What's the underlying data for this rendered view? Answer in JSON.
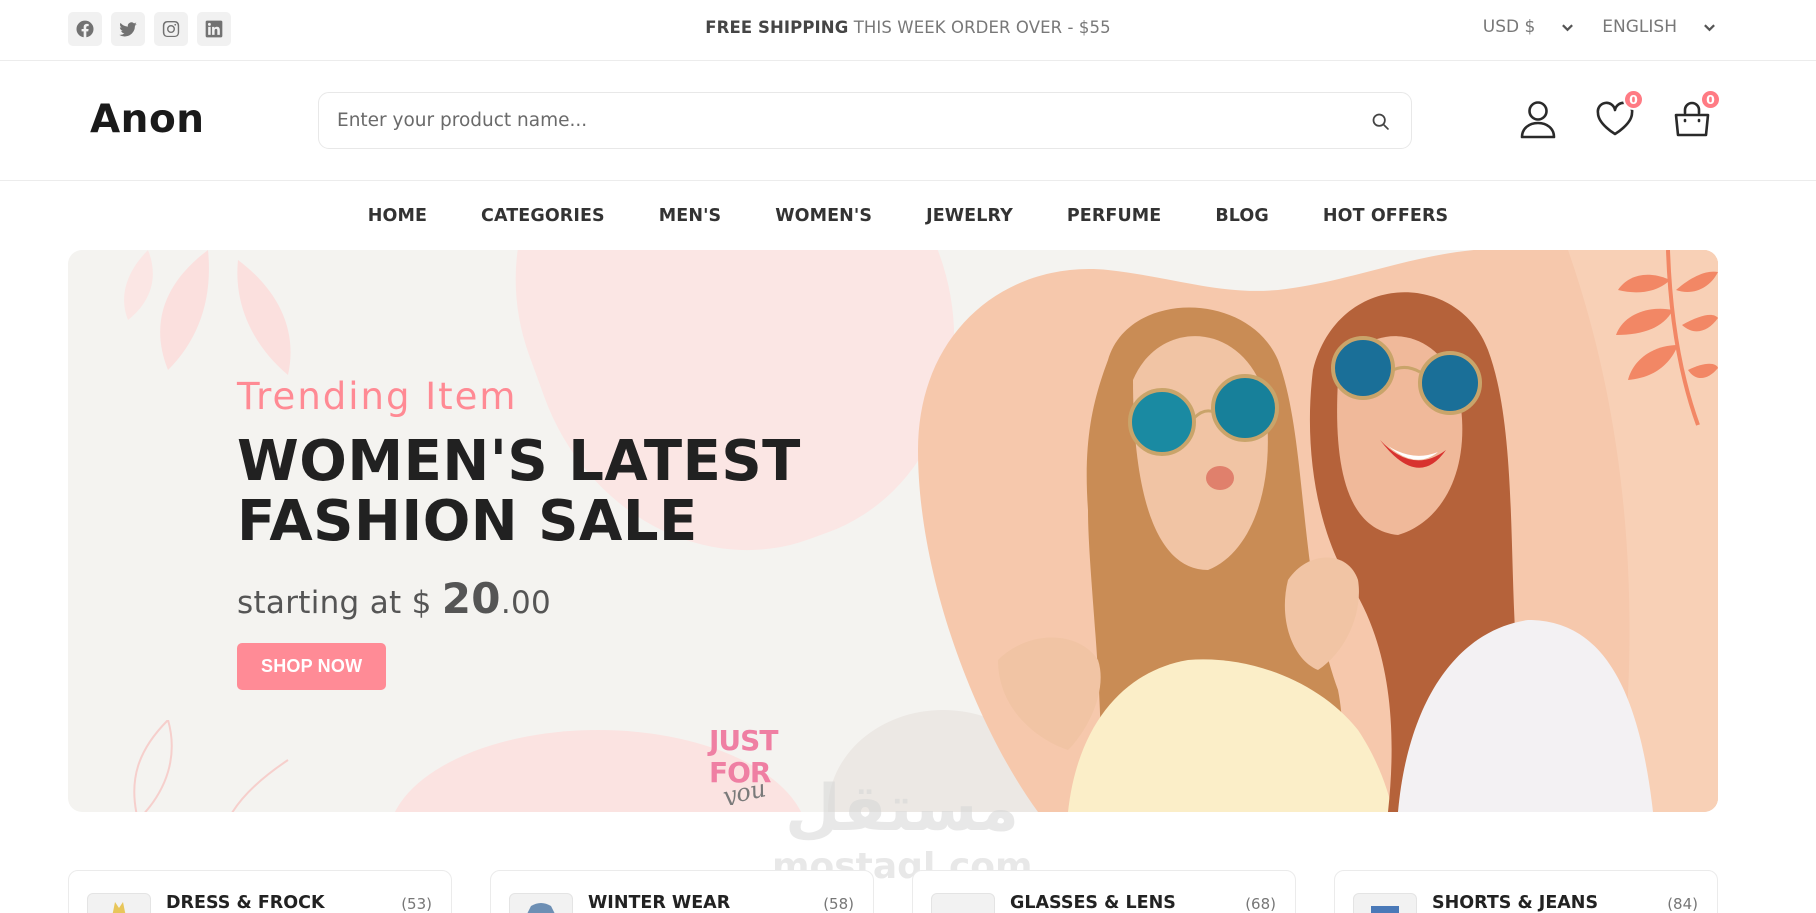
{
  "topbar": {
    "shipping_bold": "FREE SHIPPING",
    "shipping_rest": " THIS WEEK ORDER OVER - $55",
    "currency": "USD $",
    "language": "ENGLISH",
    "social": [
      "facebook-icon",
      "twitter-icon",
      "instagram-icon",
      "linkedin-icon"
    ]
  },
  "header": {
    "logo": "Anon",
    "search_placeholder": "Enter your product name...",
    "wishlist_count": "0",
    "cart_count": "0"
  },
  "nav": {
    "items": [
      "HOME",
      "CATEGORIES",
      "MEN'S",
      "WOMEN'S",
      "JEWELRY",
      "PERFUME",
      "BLOG",
      "HOT OFFERS"
    ]
  },
  "hero": {
    "eyebrow": "Trending Item",
    "title_line1": "WOMEN'S LATEST",
    "title_line2": "FASHION SALE",
    "price_prefix": "starting at $ ",
    "price_main": "20",
    "price_cents": ".00",
    "cta": "SHOP NOW",
    "stamp_line1": "JUST",
    "stamp_line2": "FOR",
    "stamp_line3": "you"
  },
  "watermark": {
    "arabic": "مستقل",
    "latin": "mostaql.com"
  },
  "categories": [
    {
      "name": "DRESS & FROCK",
      "count": "(53)"
    },
    {
      "name": "WINTER WEAR",
      "count": "(58)"
    },
    {
      "name": "GLASSES & LENS",
      "count": "(68)"
    },
    {
      "name": "SHORTS & JEANS",
      "count": "(84)"
    }
  ],
  "colors": {
    "accent_pink": "#ff8b96",
    "badge": "#ff7b84",
    "hero_bg": "#f4f3f0",
    "photo_bg": "#f6c8ac"
  }
}
